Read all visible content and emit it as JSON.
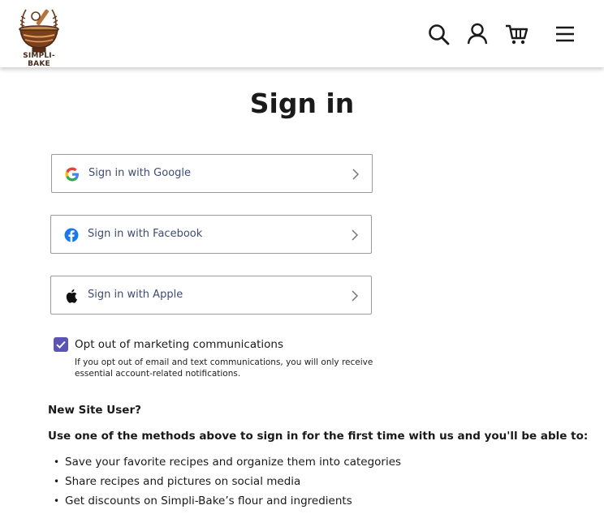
{
  "header": {
    "logo_text": "SIMPLI-BAKE",
    "icons": [
      "search-icon",
      "account-icon",
      "cart-icon",
      "menu-icon"
    ]
  },
  "page": {
    "title": "Sign in"
  },
  "sso": {
    "google_label": "Sign in with Google",
    "facebook_label": "Sign in with Facebook",
    "apple_label": "Sign in with Apple"
  },
  "marketing": {
    "checked": true,
    "label": "Opt out of marketing communications",
    "note": "If you opt out of email and text communications, you will only receive essential account-related notifications."
  },
  "new_user": {
    "heading": "New Site User?",
    "intro": "Use one of the methods above to sign in for the first time with us and you'll be able to:",
    "benefits": [
      "Save your favorite recipes and organize them into categories",
      "Share recipes and pictures on social media",
      "Get discounts on Simpli-Bake’s flour and ingredients"
    ]
  },
  "colors": {
    "checkbox": "#5a55b4",
    "button_text": "#3d4a78",
    "facebook": "#1877f2",
    "logo_brown": "#7a3f1d"
  }
}
